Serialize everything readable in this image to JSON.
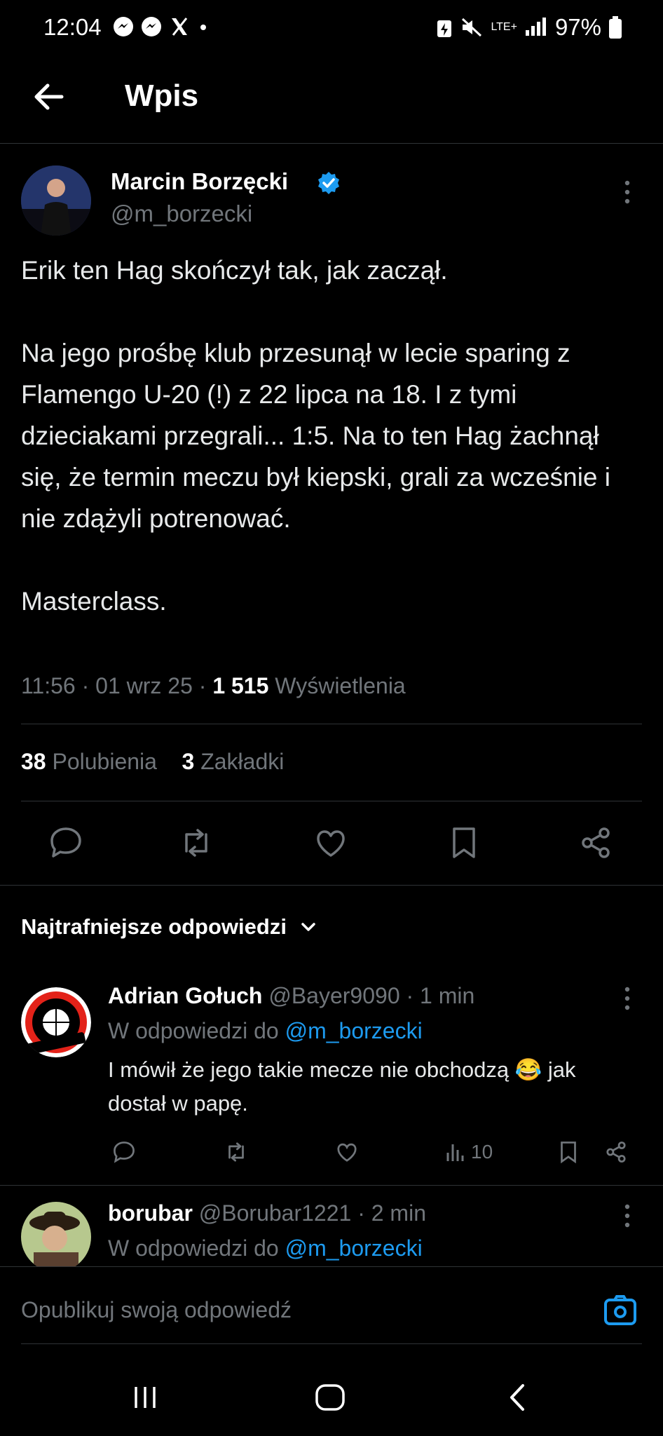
{
  "status_bar": {
    "time": "12:04",
    "battery": "97%",
    "network": "LTE+"
  },
  "header": {
    "title": "Wpis"
  },
  "tweet": {
    "author_name": "Marcin Borzęcki",
    "handle": "@m_borzecki",
    "text": "Erik ten Hag skończył tak, jak zaczął.\n\nNa jego prośbę klub przesunął w lecie sparing z Flamengo U-20 (!) z 22 lipca na 18. I z tymi dzieciakami przegrali... 1:5. Na to ten Hag żachnął się, że termin meczu był kiepski, grali za wcześnie i nie zdążyli potrenować.\n\nMasterclass.",
    "time": "11:56",
    "date": "01 wrz 25",
    "views_count": "1 515",
    "views_label": "Wyświetlenia",
    "likes_count": "38",
    "likes_label": "Polubienia",
    "bookmarks_count": "3",
    "bookmarks_label": "Zakładki"
  },
  "replies_sort": {
    "label": "Najtrafniejsze odpowiedzi"
  },
  "replies": [
    {
      "name": "Adrian Gołuch",
      "handle": "@Bayer9090",
      "age": "· 1 min",
      "reply_to_label": "W odpowiedzi do",
      "reply_to_handle": "@m_borzecki",
      "text": "I mówił że jego takie mecze nie obchodzą 😂 jak dostał w papę.",
      "views": "10"
    },
    {
      "name": "borubar",
      "handle": "@Borubar1221",
      "age": "· 2 min",
      "reply_to_label": "W odpowiedzi do",
      "reply_to_handle": "@m_borzecki"
    }
  ],
  "composer": {
    "placeholder": "Opublikuj swoją odpowiedź"
  },
  "colors": {
    "background": "#000000",
    "accent": "#1d9bf0",
    "muted": "#71767b",
    "divider": "#2f3336"
  }
}
